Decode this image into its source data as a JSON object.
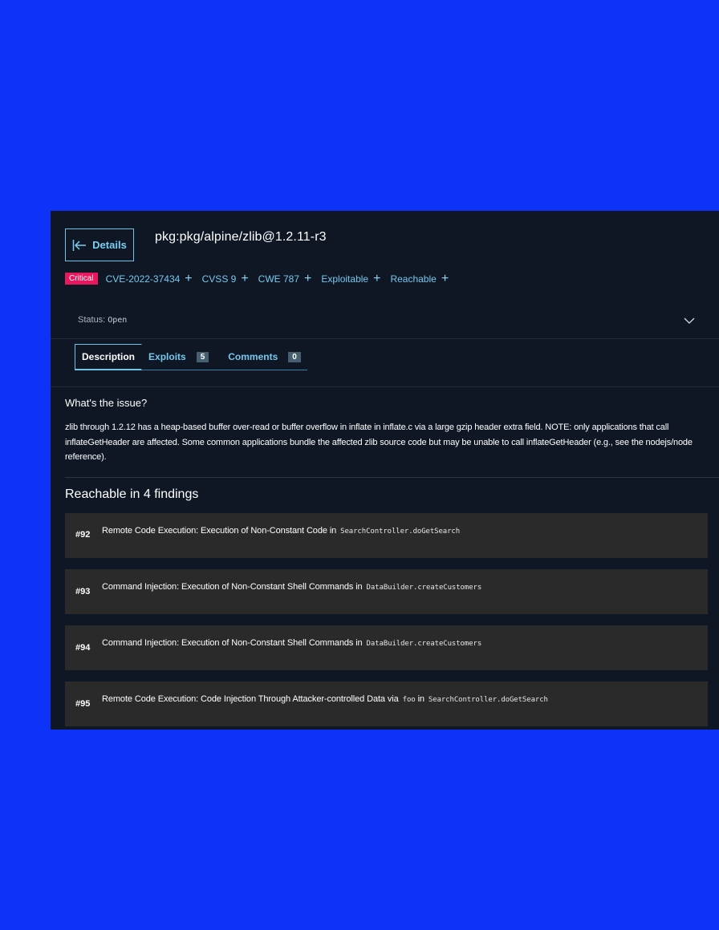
{
  "header": {
    "back_label": "Details",
    "package": "pkg:pkg/alpine/zlib@1.2.11-r3"
  },
  "tags": {
    "severity": "Critical",
    "items": [
      {
        "label": "CVE-2022-37434"
      },
      {
        "label": "CVSS 9"
      },
      {
        "label": "CWE 787"
      },
      {
        "label": "Exploitable"
      },
      {
        "label": "Reachable"
      }
    ]
  },
  "status": {
    "label": "Status:",
    "value": "Open"
  },
  "tabs": [
    {
      "label": "Description",
      "count": ""
    },
    {
      "label": "Exploits",
      "count": "5"
    },
    {
      "label": "Comments",
      "count": "0"
    }
  ],
  "issue": {
    "heading": "What's the issue?",
    "text": "zlib through 1.2.12 has a heap-based buffer over-read or buffer overflow in inflate in inflate.c via a large gzip header extra field. NOTE: only applications that call inflateGetHeader are affected. Some common applications bundle the affected zlib source code but may be unable to call inflateGetHeader (e.g., see the nodejs/node reference)."
  },
  "reachable": {
    "heading": "Reachable in 4 findings",
    "findings": [
      {
        "num": "#92",
        "title": "Remote Code Execution: Execution of Non-Constant Code in",
        "code": "SearchController.doGetSearch"
      },
      {
        "num": "#93",
        "title": "Command Injection: Execution of Non-Constant Shell Commands in",
        "code": "DataBuilder.createCustomers"
      },
      {
        "num": "#94",
        "title": "Command Injection: Execution of Non-Constant Shell Commands in",
        "code": "DataBuilder.createCustomers"
      },
      {
        "num": "#95",
        "title": "Remote Code Execution: Code Injection Through Attacker-controlled Data via",
        "code_a": "foo",
        "mid": "in",
        "code": "SearchController.doGetSearch"
      }
    ]
  },
  "colors": {
    "background": "#0c33f7",
    "panel": "#0f1725",
    "accent": "#76c8ee",
    "critical": "#e8185f",
    "finding_bg": "#2a2a2b"
  }
}
